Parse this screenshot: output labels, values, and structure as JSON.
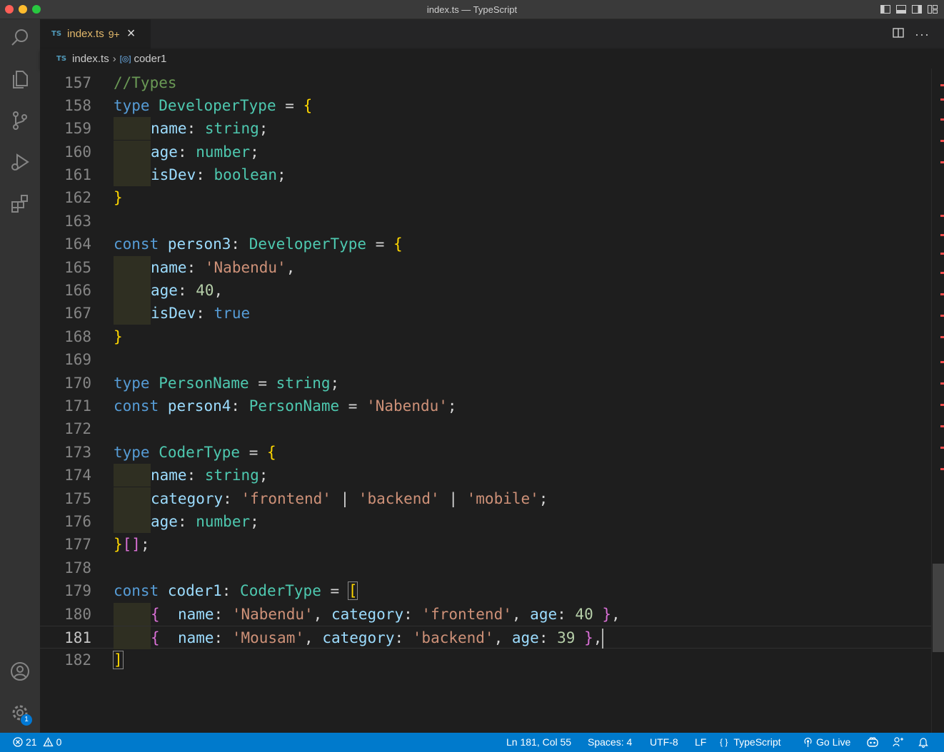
{
  "window": {
    "title": "index.ts — TypeScript"
  },
  "tab": {
    "icon": "TS",
    "name": "index.ts",
    "problems": "9+"
  },
  "breadcrumb": {
    "icon": "TS",
    "file": "index.ts",
    "symbol_icon": "[◎]",
    "symbol": "coder1"
  },
  "activity_bar": {
    "settings_badge": "1"
  },
  "editor": {
    "current_line": 181,
    "lines": [
      {
        "n": "157",
        "t": "//Types"
      },
      {
        "n": "158",
        "t": "type DeveloperType = {"
      },
      {
        "n": "159",
        "t": "    name: string;"
      },
      {
        "n": "160",
        "t": "    age: number;"
      },
      {
        "n": "161",
        "t": "    isDev: boolean;"
      },
      {
        "n": "162",
        "t": "}"
      },
      {
        "n": "163",
        "t": ""
      },
      {
        "n": "164",
        "t": "const person3: DeveloperType = {"
      },
      {
        "n": "165",
        "t": "    name: 'Nabendu',"
      },
      {
        "n": "166",
        "t": "    age: 40,"
      },
      {
        "n": "167",
        "t": "    isDev: true"
      },
      {
        "n": "168",
        "t": "}"
      },
      {
        "n": "169",
        "t": ""
      },
      {
        "n": "170",
        "t": "type PersonName = string;"
      },
      {
        "n": "171",
        "t": "const person4: PersonName = 'Nabendu';"
      },
      {
        "n": "172",
        "t": ""
      },
      {
        "n": "173",
        "t": "type CoderType = {"
      },
      {
        "n": "174",
        "t": "    name: string;"
      },
      {
        "n": "175",
        "t": "    category: 'frontend' | 'backend' | 'mobile';"
      },
      {
        "n": "176",
        "t": "    age: number;"
      },
      {
        "n": "177",
        "t": "}[];"
      },
      {
        "n": "178",
        "t": ""
      },
      {
        "n": "179",
        "t": "const coder1: CoderType = ["
      },
      {
        "n": "180",
        "t": "    {  name: 'Nabendu', category: 'frontend', age: 40 },"
      },
      {
        "n": "181",
        "t": "    {  name: 'Mousam', category: 'backend', age: 39 },"
      },
      {
        "n": "182",
        "t": "]"
      }
    ]
  },
  "status_bar": {
    "errors": "21",
    "warnings": "0",
    "position": "Ln 181, Col 55",
    "spaces": "Spaces: 4",
    "encoding": "UTF-8",
    "eol": "LF",
    "language_icon": "{ }",
    "language": "TypeScript",
    "go_live": "Go Live"
  }
}
